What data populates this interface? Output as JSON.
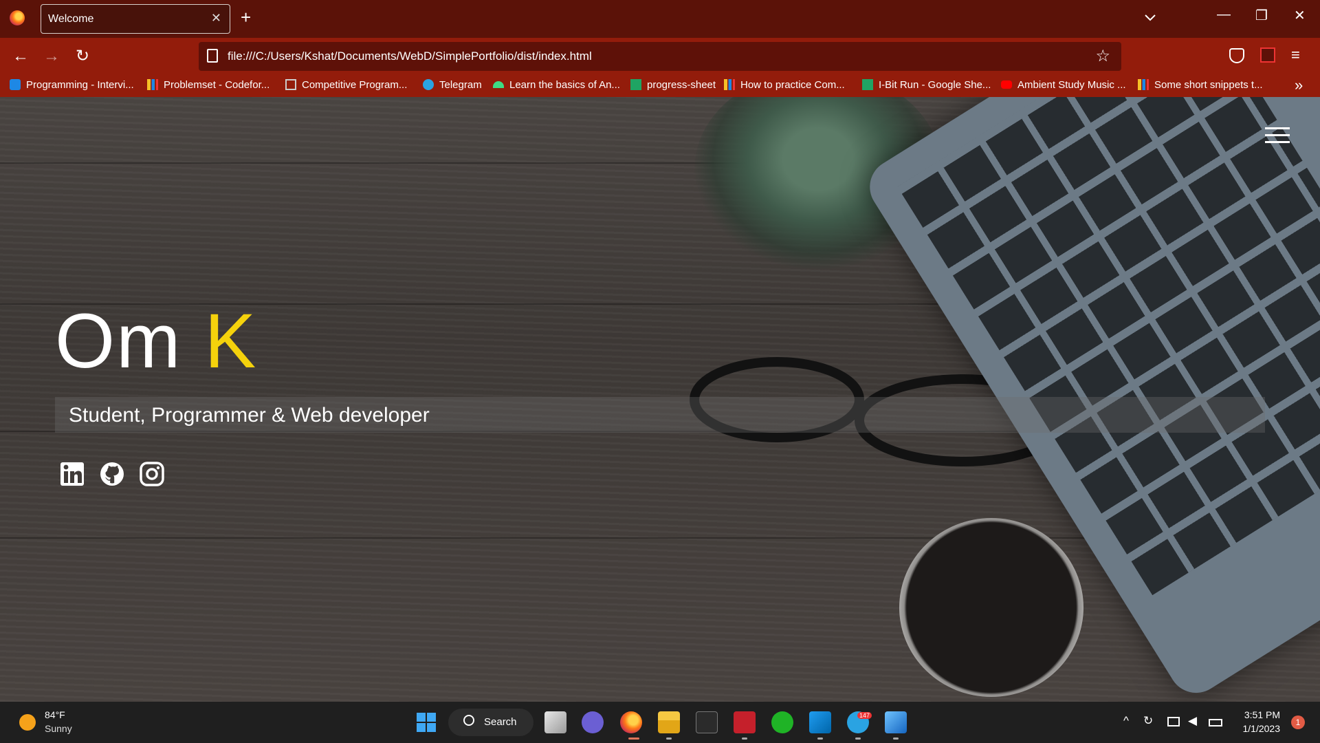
{
  "browser": {
    "tab_title": "Welcome",
    "tab_close": "✕",
    "new_tab": "+",
    "url": "file:///C:/Users/Kshat/Documents/WebD/SimplePortfolio/dist/index.html",
    "window": {
      "minimize": "—",
      "restore": "❐",
      "close": "✕"
    },
    "nav": {
      "back": "←",
      "forward": "→",
      "reload": "↻",
      "star": "☆",
      "menu": "≡"
    }
  },
  "bookmarks": [
    {
      "label": "Programming - Intervi...",
      "icon": "ib-icon",
      "color": "#1e88e5"
    },
    {
      "label": "Problemset - Codefor...",
      "icon": "bars-icon",
      "color": "#f6c026"
    },
    {
      "label": "Competitive Program...",
      "icon": "cc-icon",
      "color": "#cccccc"
    },
    {
      "label": "Telegram",
      "icon": "telegram-icon",
      "color": "#2aa3e2"
    },
    {
      "label": "Learn the basics of An...",
      "icon": "android-icon",
      "color": "#3ddc84"
    },
    {
      "label": "progress-sheet",
      "icon": "sheets-icon",
      "color": "#1fa463"
    },
    {
      "label": "How to practice Com...",
      "icon": "bars-icon",
      "color": "#f6c026"
    },
    {
      "label": "I-Bit Run - Google She...",
      "icon": "sheets-icon",
      "color": "#1fa463"
    },
    {
      "label": "Ambient Study Music ...",
      "icon": "youtube-icon",
      "color": "#ff0000"
    },
    {
      "label": "Some short snippets t...",
      "icon": "bars-icon",
      "color": "#f6c026"
    }
  ],
  "bookmarks_overflow": "»",
  "hero": {
    "first_name": "Om",
    "last_name": "K",
    "tagline": "Student, Programmer & Web developer",
    "accent_color": "#f5d20c",
    "social": [
      "linkedin-icon",
      "github-icon",
      "instagram-icon"
    ]
  },
  "taskbar": {
    "weather_temp": "84°F",
    "weather_desc": "Sunny",
    "search_label": "Search",
    "telegram_badge": "147",
    "time": "3:51 PM",
    "date": "1/1/2023",
    "notifications": "1"
  }
}
